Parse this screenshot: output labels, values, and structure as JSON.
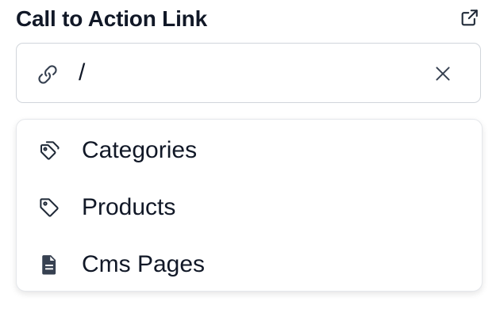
{
  "header": {
    "title": "Call to Action Link",
    "open_icon": "external-link-icon"
  },
  "input": {
    "value": "/",
    "leading_icon": "link-icon",
    "clear_icon": "close-icon"
  },
  "dropdown": {
    "items": [
      {
        "label": "Categories",
        "icon": "tags-icon"
      },
      {
        "label": "Products",
        "icon": "tag-icon"
      },
      {
        "label": "Cms Pages",
        "icon": "document-icon"
      }
    ]
  },
  "colors": {
    "text": "#111827",
    "icon": "#374151",
    "border": "#d1d5db"
  }
}
